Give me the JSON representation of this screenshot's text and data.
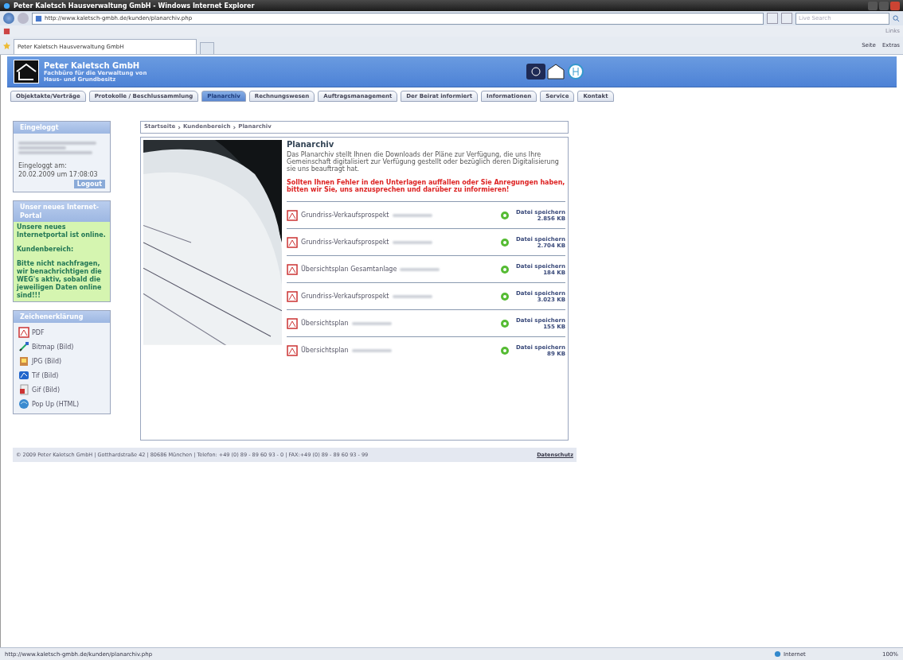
{
  "window": {
    "title": "Peter Kaletsch Hausverwaltung GmbH - Windows Internet Explorer"
  },
  "address_bar": {
    "url": "http://www.kaletsch-gmbh.de/kunden/planarchiv.php"
  },
  "search": {
    "placeholder": "Live Search"
  },
  "links_label": "Links",
  "browser_tab": {
    "title": "Peter Kaletsch Hausverwaltung GmbH"
  },
  "command_bar": [
    "Seite",
    "Extras"
  ],
  "header": {
    "company": "Peter Kaletsch GmbH",
    "subtitle_lines": [
      "Fachbüro für die Verwaltung von",
      "Haus- und Grundbesitz"
    ]
  },
  "nav": [
    {
      "label": "Objektakte/Verträge",
      "selected": false
    },
    {
      "label": "Protokolle / Beschlussammlung",
      "selected": false
    },
    {
      "label": "Planarchiv",
      "selected": true
    },
    {
      "label": "Rechnungswesen",
      "selected": false
    },
    {
      "label": "Auftragsmanagement",
      "selected": false
    },
    {
      "label": "Der Beirat informiert",
      "selected": false
    },
    {
      "label": "Informationen",
      "selected": false
    },
    {
      "label": "Service",
      "selected": false
    },
    {
      "label": "Kontakt",
      "selected": false
    }
  ],
  "login_panel": {
    "title": "Eingeloggt",
    "info_lines": [
      "Eingeloggt am:",
      "20.02.2009 um 17:08:03"
    ],
    "logout": "Logout"
  },
  "news_panel": {
    "title": "Unser neues Internet-Portal",
    "paragraphs": [
      "Unsere neues Internetportal ist online.",
      "Kundenbereich:",
      "Bitte nicht nachfragen, wir benachrichtigen die WEG's aktiv, sobald die jeweiligen Daten online sind!!!"
    ]
  },
  "legend_panel": {
    "title": "Zeichenerklärung",
    "items": [
      {
        "kind": "pdf",
        "label": "PDF"
      },
      {
        "kind": "bitmap",
        "label": "Bitmap (Bild)"
      },
      {
        "kind": "jpg",
        "label": "JPG (Bild)"
      },
      {
        "kind": "tif",
        "label": "Tif (Bild)"
      },
      {
        "kind": "gif",
        "label": "Gif (Bild)"
      },
      {
        "kind": "popup",
        "label": "Pop Up (HTML)"
      }
    ]
  },
  "breadcrumb": [
    "Startseite",
    "Kundenbereich",
    "Planarchiv"
  ],
  "breadcrumb_separator": "›",
  "content": {
    "heading": "Planarchiv",
    "intro": "Das Planarchiv stellt Ihnen die Downloads der Pläne zur Verfügung, die uns Ihre Gemeinschaft digitalisiert zur Verfügung gestellt oder bezüglich deren Digitalisierung sie uns beauftragt hat.",
    "warning": "Sollten Ihnen Fehler in den Unterlagen auffallen oder Sie Anregungen haben, bitten wir Sie, uns anzusprechen und darüber zu informieren!"
  },
  "files": [
    {
      "name": "Grundriss-Verkaufsprospekt",
      "action": "Datei speichern",
      "size": "2.856 KB"
    },
    {
      "name": "Grundriss-Verkaufsprospekt",
      "action": "Datei speichern",
      "size": "2.704 KB"
    },
    {
      "name": "Übersichtsplan Gesamtanlage",
      "action": "Datei speichern",
      "size": "184 KB"
    },
    {
      "name": "Grundriss-Verkaufsprospekt",
      "action": "Datei speichern",
      "size": "3.023 KB"
    },
    {
      "name": "Übersichtsplan",
      "action": "Datei speichern",
      "size": "155 KB"
    },
    {
      "name": "Übersichtsplan",
      "action": "Datei speichern",
      "size": "89 KB"
    }
  ],
  "footer": {
    "text": "© 2009 Peter Kaletsch GmbH | Gotthardstraße 42 | 80686 München | Telefon: +49 (0) 89 - 89 60 93 - 0 | FAX:+49 (0) 89 - 89 60 93 - 99",
    "link": "Datenschutz"
  },
  "status_bar": {
    "url": "http://www.kaletsch-gmbh.de/kunden/planarchiv.php",
    "zone": "Internet",
    "zoom": "100%"
  }
}
